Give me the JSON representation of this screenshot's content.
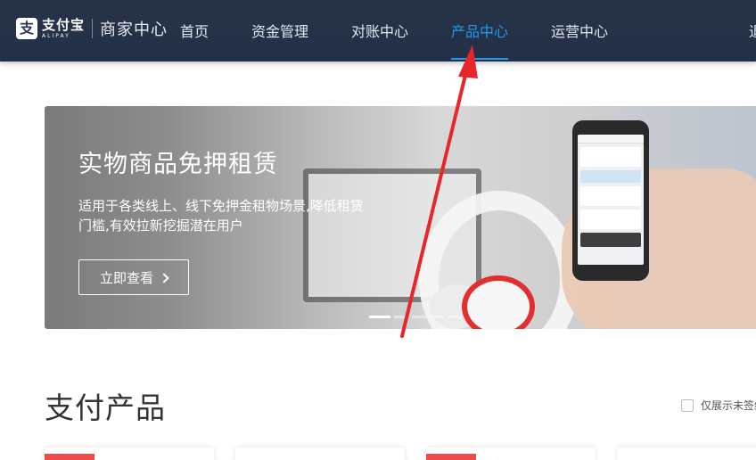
{
  "header": {
    "logo_cn": "支付宝",
    "logo_en": "ALIPAY",
    "logo_glyph": "支",
    "subtitle": "商家中心",
    "nav": [
      {
        "label": "首页",
        "active": false
      },
      {
        "label": "资金管理",
        "active": false
      },
      {
        "label": "对账中心",
        "active": false
      },
      {
        "label": "产品中心",
        "active": true
      },
      {
        "label": "运营中心",
        "active": false
      },
      {
        "label": "退",
        "active": false
      }
    ],
    "active_color": "#1e9bf0"
  },
  "banner": {
    "title": "实物商品免押租赁",
    "description": "适用于各类线上、线下免押金租物场景,降低租赁门槛,有效拉新挖掘潜在用户",
    "button_label": "立即查看",
    "slides_count": 5,
    "active_slide": 1
  },
  "section": {
    "title": "支付产品",
    "filter_label": "仅展示未签约"
  },
  "colors": {
    "nav_bg": "#263246",
    "accent": "#1e9bf0",
    "annotation_arrow": "#e8262a",
    "tag_red": "#ef4b4b"
  }
}
